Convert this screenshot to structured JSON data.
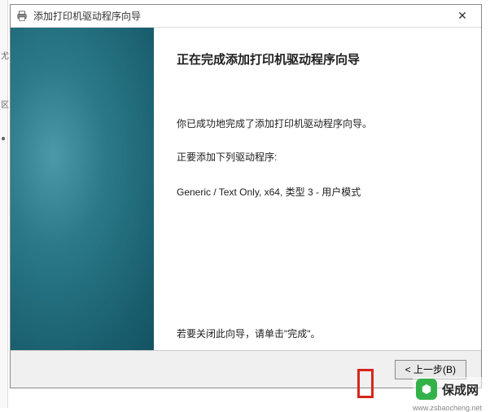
{
  "dialog": {
    "title": "添加打印机驱动程序向导",
    "close_icon": "✕"
  },
  "content": {
    "heading": "正在完成添加打印机驱动程序向导",
    "success_text": "你已成功地完成了添加打印机驱动程序向导。",
    "adding_label": "正要添加下列驱动程序:",
    "driver_line": "Generic / Text Only, x64, 类型 3 - 用户模式",
    "footnote": "若要关闭此向导，请单击\"完成\"。"
  },
  "buttons": {
    "back": "< 上一步(B)"
  },
  "watermark": {
    "brand": "保成网",
    "url": "www.zsbaocheng.net"
  }
}
